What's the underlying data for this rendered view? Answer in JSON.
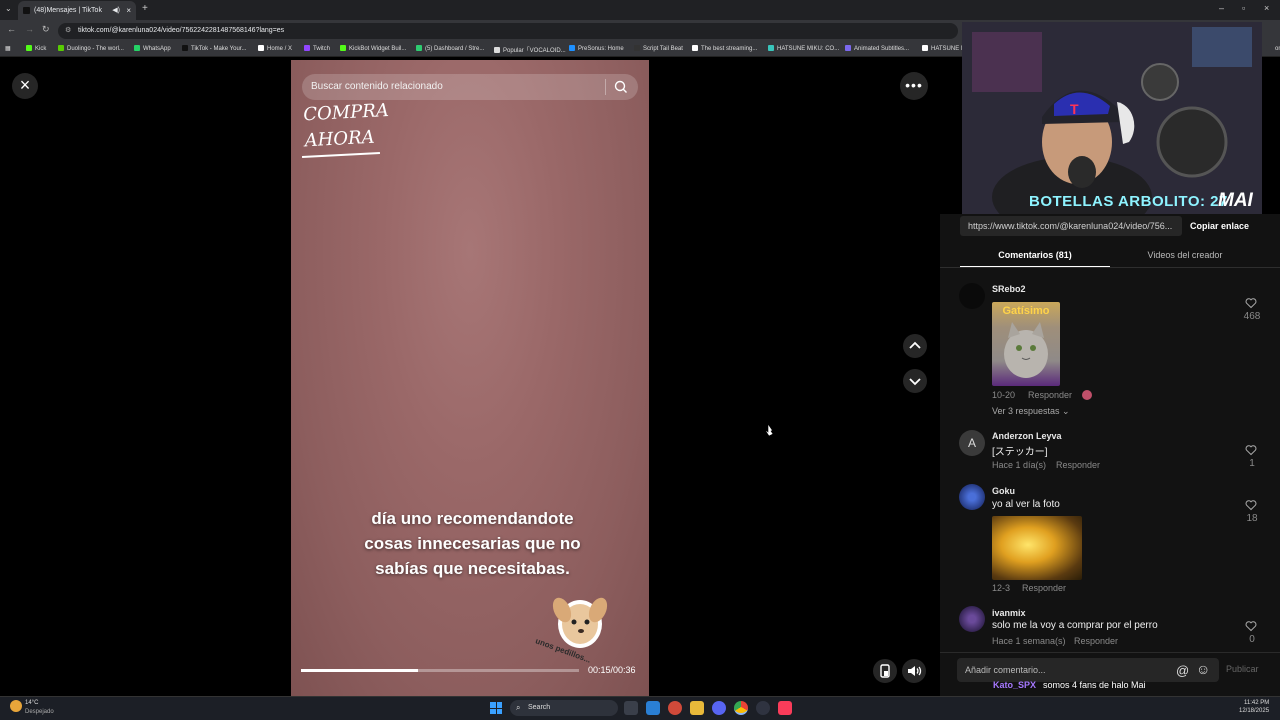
{
  "browser": {
    "tab_title": "(48)Mensajes | TikTok",
    "url": "tiktok.com/@karenluna024/video/7562242281487568146?lang=es",
    "bookmarks": [
      {
        "label": "Kick",
        "color": "#53fc18"
      },
      {
        "label": "Duolingo - The worl...",
        "color": "#58cc02"
      },
      {
        "label": "WhatsApp",
        "color": "#25d366"
      },
      {
        "label": "TikTok - Make Your...",
        "color": "#111111"
      },
      {
        "label": "Home / X",
        "color": "#ffffff"
      },
      {
        "label": "Twitch",
        "color": "#9146ff"
      },
      {
        "label": "KickBot Widget Buil...",
        "color": "#53fc18"
      },
      {
        "label": "(5) Dashboard / Stre...",
        "color": "#2ecc71"
      },
      {
        "label": "Popular「VOCALOID...",
        "color": "#dddddd"
      },
      {
        "label": "PreSonus: Home",
        "color": "#1e90ff"
      },
      {
        "label": "Script Tail Beat",
        "color": "#333333"
      },
      {
        "label": "The best streaming...",
        "color": "#ffffff"
      },
      {
        "label": "HATSUNE MIKU: CO...",
        "color": "#39c5bb"
      },
      {
        "label": "Animated Subtitles...",
        "color": "#7b68ee"
      },
      {
        "label": "HATSUNE MIKU",
        "color": "#ffffff"
      },
      {
        "label": "ores",
        "color": "#35363a"
      }
    ]
  },
  "video": {
    "search_placeholder": "Buscar contenido relacionado",
    "handwritten_text": "COMPRA\nAHORA",
    "caption": "día uno recomendandote\ncosas innecesarias que no\nsabías que necesitabas.",
    "sticker_text": "unos pedillos...",
    "time": "00:15/00:36",
    "progress": 0.42
  },
  "stream_overlay": {
    "label": "BOTELLAS ARBOLITO: 27",
    "logo": "MAI"
  },
  "panel": {
    "link": "https://www.tiktok.com/@karenluna024/video/756...",
    "copy_link": "Copiar enlace",
    "tab_comments": "Comentarios (81)",
    "tab_creator": "Videos del creador",
    "comments": [
      {
        "user": "SRebo2",
        "text": "",
        "image_title": "Gatísimo",
        "date": "10-20",
        "reply": "Responder",
        "likes": "468",
        "view_replies": "Ver 3 respuestas"
      },
      {
        "user": "Anderzon Leyva",
        "avatar_letter": "A",
        "text": "[ステッカー]",
        "date": "Hace 1 día(s)",
        "reply": "Responder",
        "likes": "1"
      },
      {
        "user": "Goku",
        "text": "yo al ver la foto",
        "date": "12-3",
        "reply": "Responder",
        "likes": "18"
      },
      {
        "user": "ivanmix",
        "text": "solo me la voy a comprar por el perro",
        "date": "Hace 1 semana(s)",
        "reply": "Responder",
        "likes": "0"
      }
    ],
    "add_comment_placeholder": "Añadir comentario...",
    "publish": "Publicar",
    "chat_user": "Kato_SPX",
    "chat_message": "somos 4 fans de halo Mai"
  },
  "taskbar": {
    "weather_temp": "14°C",
    "weather_desc": "Despejado",
    "search": "Search",
    "time": "11:42 PM",
    "date": "12/18/2025"
  }
}
